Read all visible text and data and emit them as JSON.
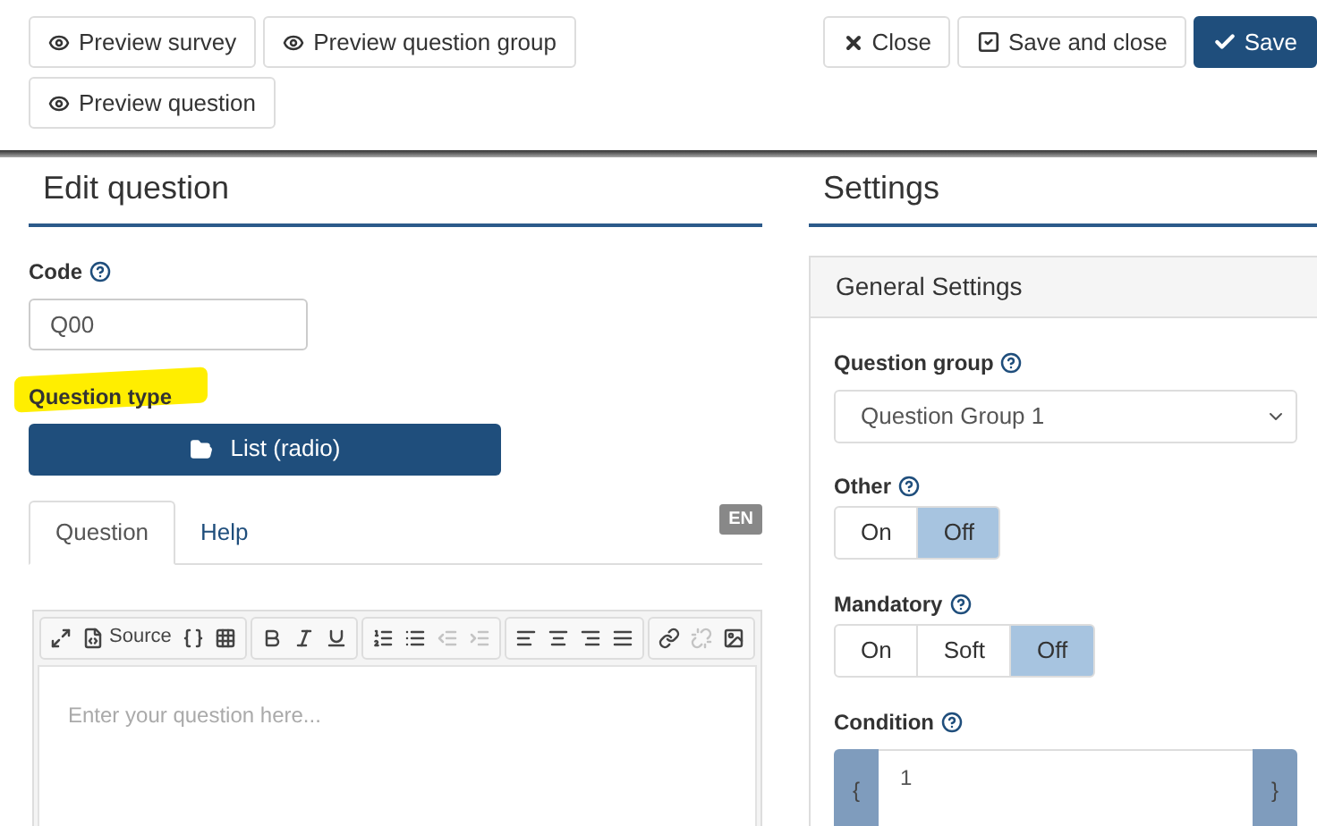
{
  "toolbar": {
    "left_buttons": [
      {
        "label": "Preview survey"
      },
      {
        "label": "Preview question group"
      },
      {
        "label": "Preview question"
      }
    ],
    "right_buttons": [
      {
        "label": "Close",
        "kind": "close",
        "primary": false
      },
      {
        "label": "Save and close",
        "kind": "check-square",
        "primary": false
      },
      {
        "label": "Save",
        "kind": "check",
        "primary": true
      }
    ]
  },
  "edit_question": {
    "title": "Edit question",
    "code_label": "Code",
    "code_value": "Q00",
    "question_type_label": "Question type",
    "question_type_value": "List (radio)",
    "tabs": [
      {
        "label": "Question",
        "selected": true
      },
      {
        "label": "Help",
        "selected": false
      }
    ],
    "language_badge": "EN",
    "editor": {
      "toolbar_groups": [
        [
          {
            "disabled": false
          },
          {
            "disabled": false,
            "label": "Source"
          },
          {
            "disabled": false
          },
          {
            "disabled": false
          }
        ],
        [
          {
            "disabled": false
          },
          {
            "disabled": false
          },
          {
            "disabled": false
          }
        ],
        [
          {
            "disabled": false
          },
          {
            "disabled": false
          },
          {
            "disabled": true
          },
          {
            "disabled": true
          }
        ],
        [
          {
            "disabled": false
          },
          {
            "disabled": false
          },
          {
            "disabled": false
          },
          {
            "disabled": false
          }
        ],
        [
          {
            "disabled": false
          },
          {
            "disabled": true
          },
          {
            "disabled": false
          }
        ]
      ],
      "placeholder": "Enter your question here..."
    }
  },
  "settings": {
    "title": "Settings",
    "panel_title": "General Settings",
    "question_group_label": "Question group",
    "question_group_value": "Question Group 1",
    "other": {
      "label": "Other",
      "options": [
        {
          "label": "On",
          "selected": false
        },
        {
          "label": "Off",
          "selected": true
        }
      ]
    },
    "mandatory": {
      "label": "Mandatory",
      "options": [
        {
          "label": "On",
          "selected": false
        },
        {
          "label": "Soft",
          "selected": false
        },
        {
          "label": "Off",
          "selected": true
        }
      ]
    },
    "condition": {
      "label": "Condition",
      "open": "{",
      "value": "1",
      "close": "}"
    }
  }
}
